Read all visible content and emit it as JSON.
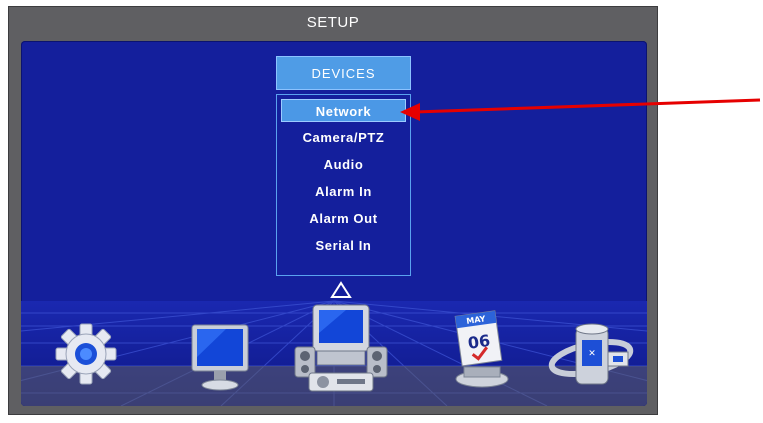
{
  "window": {
    "title": "SETUP"
  },
  "menu": {
    "header": "DEVICES",
    "items": [
      {
        "label": "Network",
        "selected": true
      },
      {
        "label": "Camera/PTZ",
        "selected": false
      },
      {
        "label": "Audio",
        "selected": false
      },
      {
        "label": "Alarm In",
        "selected": false
      },
      {
        "label": "Alarm Out",
        "selected": false
      },
      {
        "label": "Serial In",
        "selected": false
      }
    ]
  },
  "carousel": {
    "indicator": "up-arrow",
    "icons": [
      "gear-icon",
      "monitor-icon",
      "devices-icon",
      "calendar-icon",
      "database-icon"
    ],
    "calendar": {
      "month": "MAY",
      "day": "06"
    }
  },
  "annotation": {
    "color": "#e60000"
  },
  "colors": {
    "screen_bg": "#141f9c",
    "highlight": "#4b98e6",
    "frame": "#5f5f62"
  }
}
